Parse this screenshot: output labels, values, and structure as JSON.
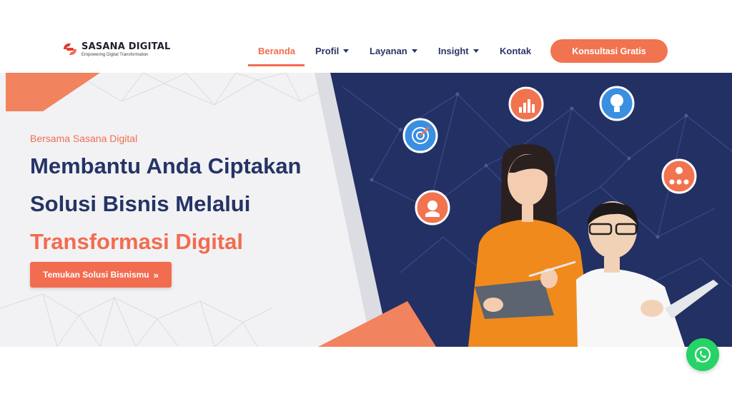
{
  "brand": {
    "name": "SASANA DIGITAL",
    "tagline": "Empowering Digital Transformation",
    "accent": "#f26c4f",
    "navy": "#253466"
  },
  "nav": {
    "items": [
      {
        "label": "Beranda",
        "active": true
      },
      {
        "label": "Profil",
        "dropdown": true
      },
      {
        "label": "Layanan",
        "dropdown": true
      },
      {
        "label": "Insight",
        "dropdown": true
      },
      {
        "label": "Kontak"
      }
    ],
    "cta": "Konsultasi Gratis"
  },
  "hero": {
    "eyebrow": "Bersama Sasana Digital",
    "headline_line1": "Membantu Anda Ciptakan",
    "headline_line2": "Solusi Bisnis Melalui",
    "headline_accent": "Transformasi Digital",
    "button_label": "Temukan Solusi Bisnismu",
    "button_icon": "double-chevron-right-icon",
    "floating_icons": [
      "target-icon",
      "chart-icon",
      "lightbulb-icon",
      "support-headset-icon",
      "network-share-icon"
    ]
  },
  "whatsapp": {
    "icon": "whatsapp-icon",
    "color": "#25d366"
  }
}
